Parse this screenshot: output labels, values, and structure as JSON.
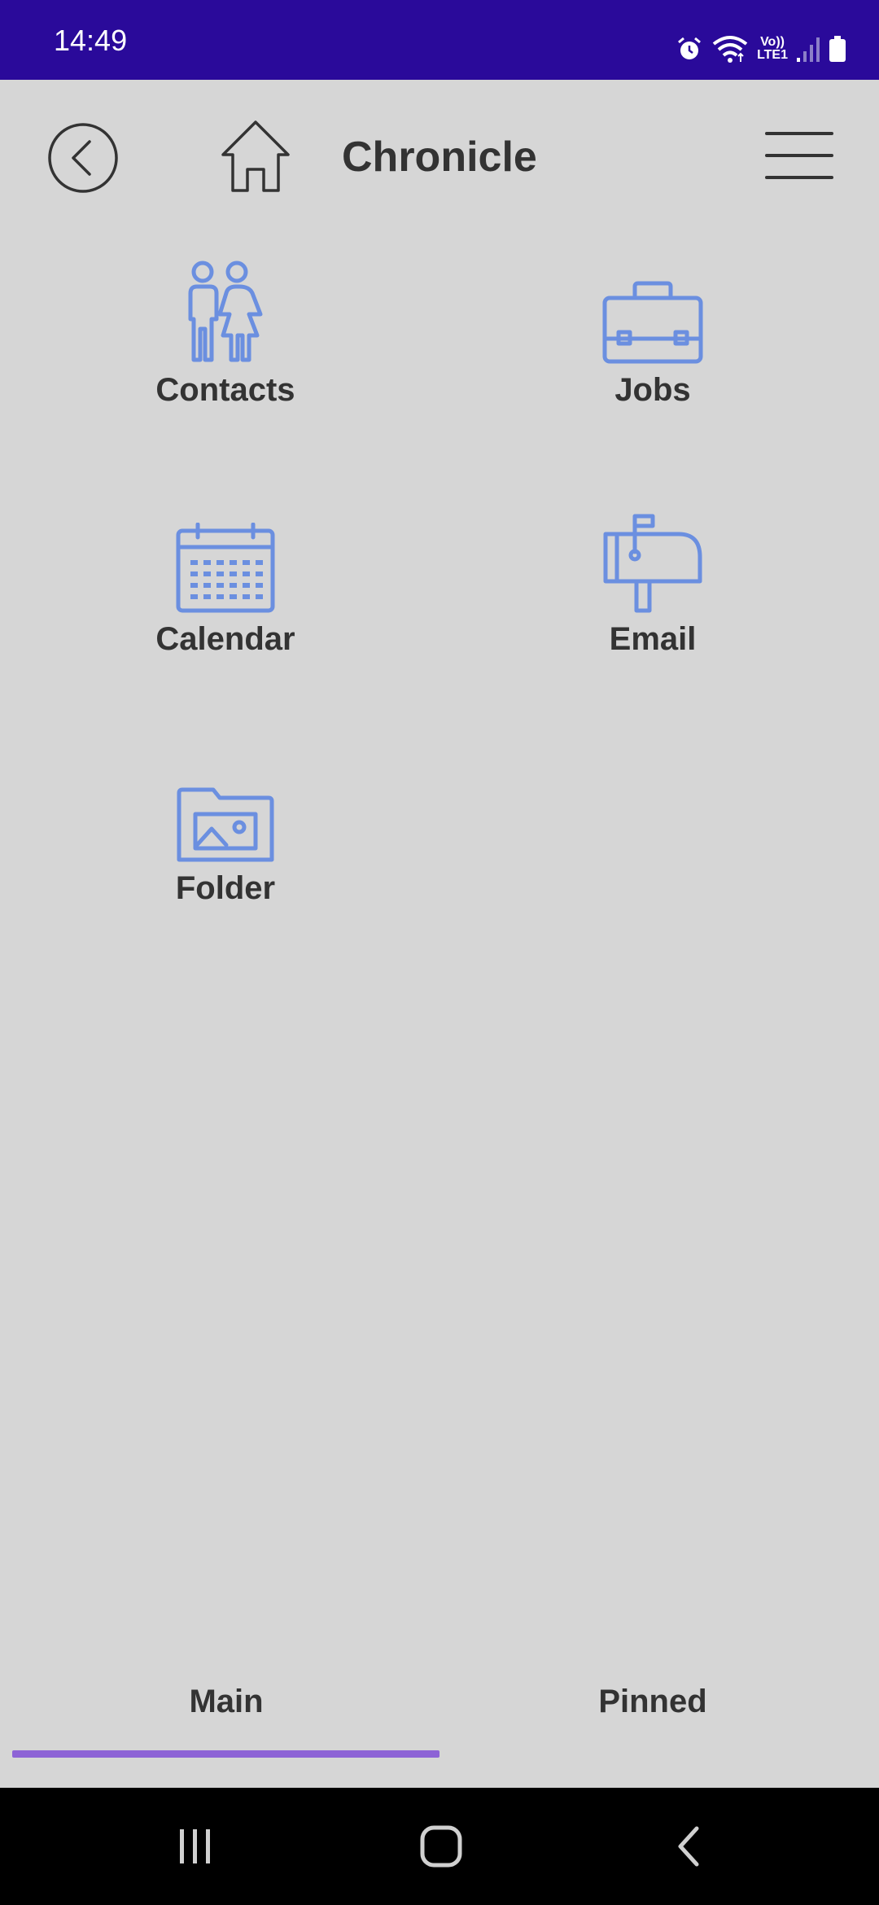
{
  "status_bar": {
    "time": "14:49",
    "lte_top": "Vo))",
    "lte_bottom": "LTE1",
    "icons": [
      "alarm-icon",
      "wifi-icon",
      "volte-icon",
      "signal-icon",
      "battery-icon"
    ]
  },
  "header": {
    "title": "Chronicle",
    "back_icon": "back-circle-icon",
    "home_icon": "home-icon",
    "menu_icon": "hamburger-menu-icon"
  },
  "tiles": [
    {
      "label": "Contacts",
      "icon": "people-icon"
    },
    {
      "label": "Jobs",
      "icon": "briefcase-icon"
    },
    {
      "label": "Calendar",
      "icon": "calendar-icon"
    },
    {
      "label": "Email",
      "icon": "mailbox-icon"
    },
    {
      "label": "Folder",
      "icon": "image-folder-icon"
    }
  ],
  "tabs": [
    {
      "label": "Main",
      "selected": true
    },
    {
      "label": "Pinned",
      "selected": false
    }
  ],
  "colors": {
    "status_bar": "#2a0a9a",
    "background": "#d6d6d6",
    "icon_accent": "#6b8fe0",
    "text": "#333333",
    "tab_indicator": "#8d63d6"
  },
  "nav_bar": {
    "icons": [
      "recent-apps-icon",
      "home-button-icon",
      "back-button-icon"
    ]
  }
}
